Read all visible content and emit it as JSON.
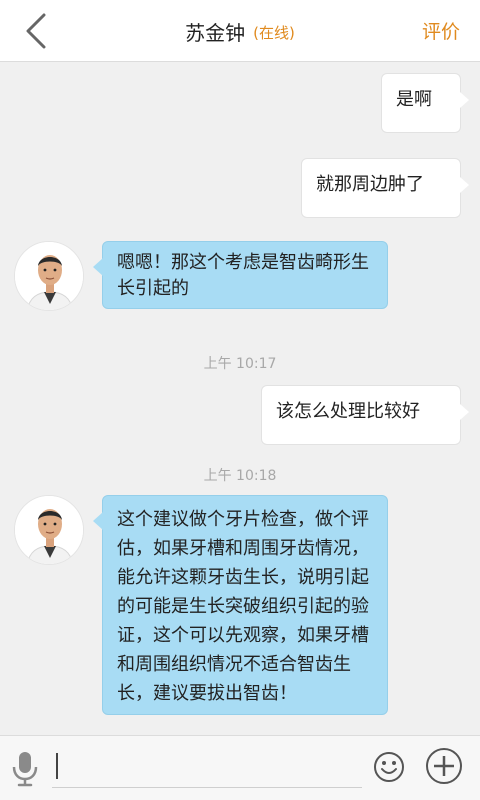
{
  "header": {
    "back_icon": "chevron-left-icon",
    "title": "苏金钟",
    "status": "(在线)",
    "rate_label": "评价",
    "accent_color": "#e08a1e"
  },
  "messages": [
    {
      "side": "right",
      "text": "是啊"
    },
    {
      "side": "right",
      "text": "就那周边肿了"
    },
    {
      "side": "left",
      "text": "嗯嗯！那这个考虑是智齿畸形生长引起的"
    },
    {
      "type": "timestamp",
      "text": "上午 10:17"
    },
    {
      "side": "right",
      "text": "该怎么处理比较好"
    },
    {
      "type": "timestamp",
      "text": "上午 10:18"
    },
    {
      "side": "left",
      "text": "这个建议做个牙片检查，做个评估，如果牙槽和周围牙齿情况，能允许这颗牙齿生长，说明引起的可能是生长突破组织引起的验证，这个可以先观察，如果牙槽和周围组织情况不适合智齿生长，建议要拔出智齿！"
    }
  ],
  "input": {
    "value": "",
    "mic_icon": "microphone-icon",
    "emoji_icon": "smiley-icon",
    "plus_icon": "plus-icon"
  },
  "colors": {
    "doctor_bubble": "#a8dcf4",
    "user_bubble": "#ffffff",
    "background": "#f0f0f0"
  }
}
